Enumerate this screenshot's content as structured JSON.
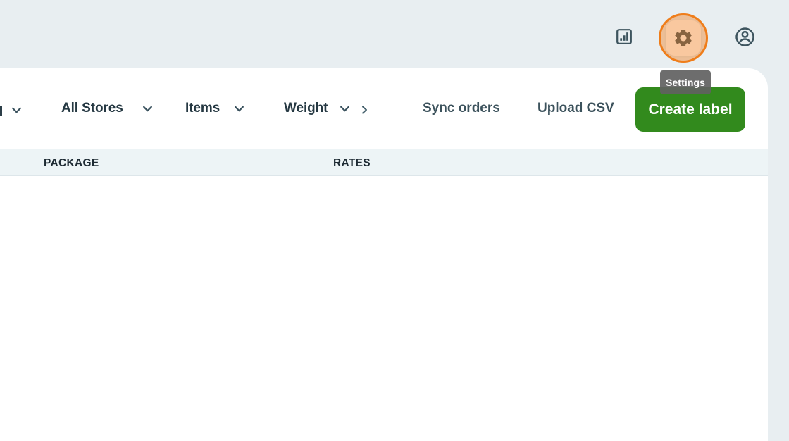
{
  "topbar": {
    "settings_tooltip": "Settings",
    "icons": {
      "analytics": "bar-chart-icon",
      "settings": "gear-icon",
      "account": "user-circle-icon"
    }
  },
  "toolbar": {
    "filters": [
      {
        "label": "All Stores"
      },
      {
        "label": "Items"
      },
      {
        "label": "Weight"
      }
    ],
    "more_filters_icon": "chevron-right",
    "actions": [
      {
        "label": "Sync orders"
      },
      {
        "label": "Upload CSV"
      }
    ],
    "create_label_button": "Create label"
  },
  "table": {
    "columns": [
      {
        "label": "PACKAGE"
      },
      {
        "label": "RATES"
      }
    ],
    "rows": []
  },
  "colors": {
    "topbar_bg": "#e8eef1",
    "card_bg": "#ffffff",
    "table_header_bg": "#edf4f6",
    "accent_green": "#328a1d",
    "highlight_orange_border": "#ef7d1a",
    "highlight_orange_fill": "rgba(240,125,26,0.42)",
    "tooltip_bg": "#616161",
    "text_dark": "#253842",
    "icon_slate": "#3d545e"
  }
}
